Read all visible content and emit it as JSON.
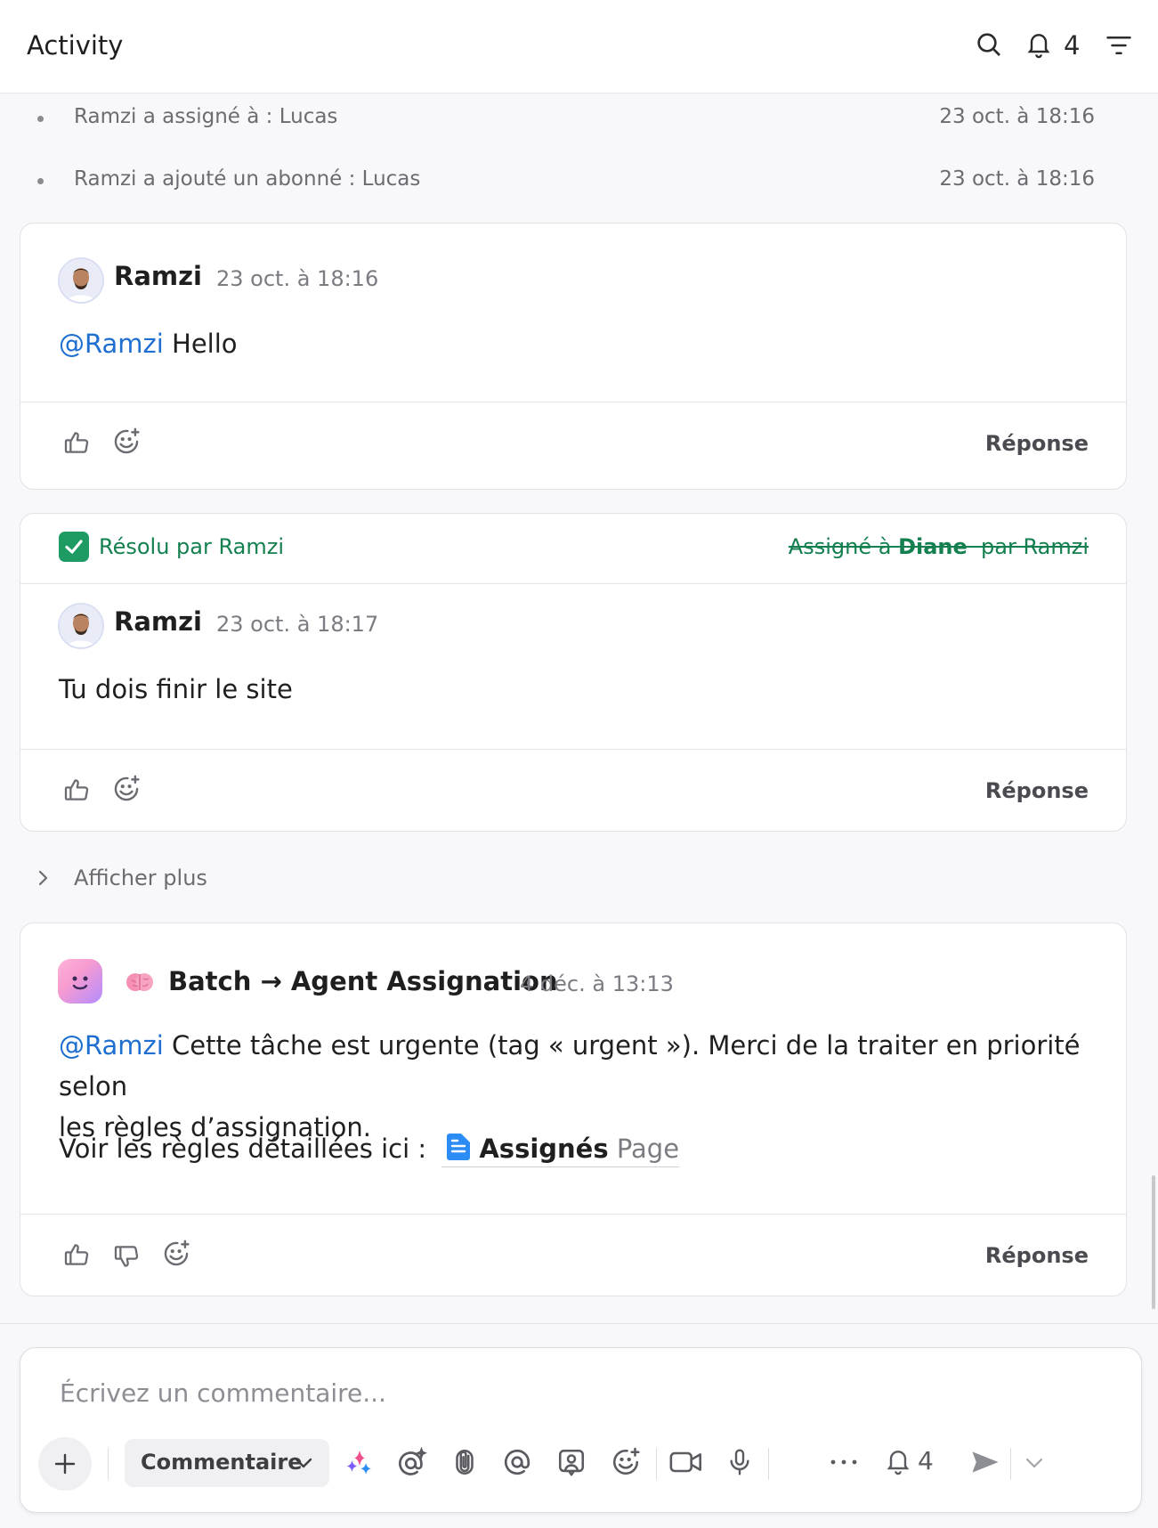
{
  "header": {
    "title": "Activity",
    "notification_count": "4"
  },
  "history": [
    {
      "text": "Ramzi a assigné à : Lucas",
      "time": "23 oct. à 18:16"
    },
    {
      "text": "Ramzi a ajouté un abonné : Lucas",
      "time": "23 oct. à 18:16"
    }
  ],
  "comments": [
    {
      "author": "Ramzi",
      "time": "23 oct. à 18:16",
      "mention": "@Ramzi",
      "text": " Hello",
      "reply_label": "Réponse"
    },
    {
      "resolved_label": "Résolu par Ramzi",
      "assigned_prefix": "Assigné à ",
      "assigned_name": "Diane",
      "assigned_suffix": "  par Ramzi",
      "author": "Ramzi",
      "time": "23 oct. à 18:17",
      "text": "Tu dois finir le site",
      "reply_label": "Réponse"
    },
    {
      "author": "Batch → Agent Assignation",
      "time": "4 déc. à 13:13",
      "mention": "@Ramzi",
      "text_line1": " Cette tâche est urgente (tag « urgent »). Merci de la traiter en priorité selon",
      "text_line2": "les règles d’assignation.",
      "rules_prefix": "Voir les règles détaillées ici :",
      "doc_name": "Assignés",
      "doc_type": "Page",
      "reply_label": "Réponse"
    }
  ],
  "show_more_label": "Afficher plus",
  "composer": {
    "placeholder": "Écrivez un commentaire...",
    "type_label": "Commentaire",
    "notification_count": "4"
  },
  "colors": {
    "accent": "#1f6fd1",
    "resolved": "#14804f",
    "doc_icon": "#2b8cf5"
  }
}
